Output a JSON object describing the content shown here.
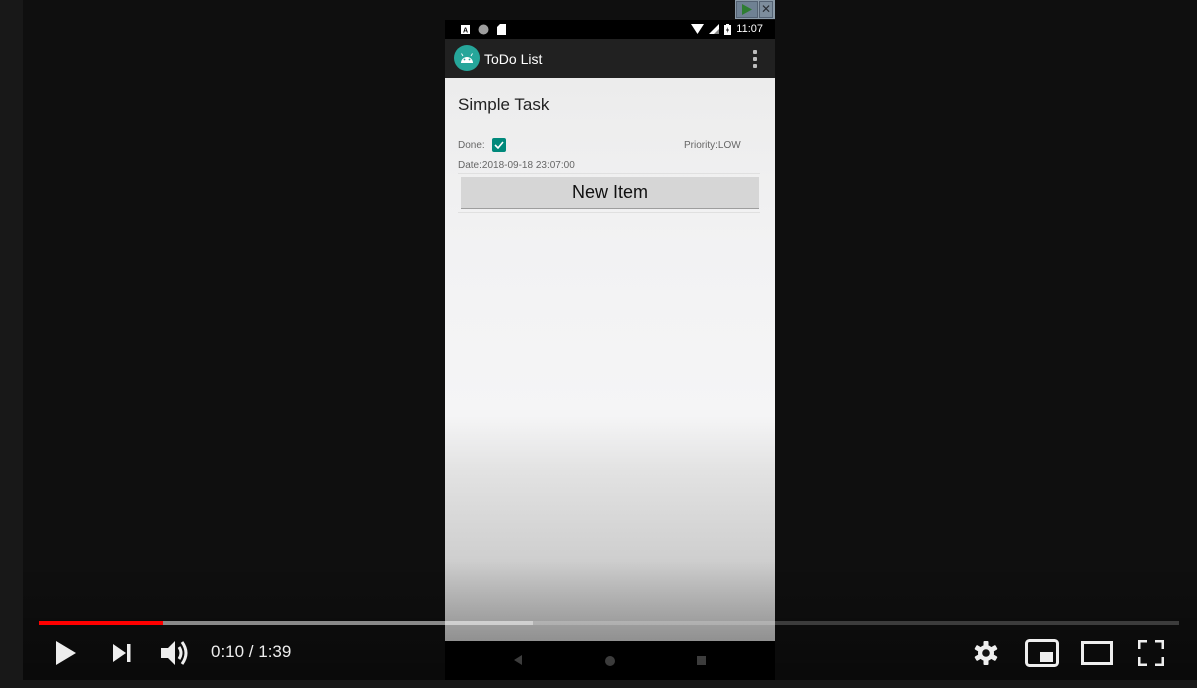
{
  "emulator": {
    "status_bar": {
      "left_icons": [
        "a-notification-icon",
        "circle-notification-icon",
        "sd-card-icon"
      ],
      "time": "11:07"
    },
    "app_bar": {
      "title": "ToDo List",
      "icon": "android-icon",
      "overflow_icon": "more-vert-icon"
    },
    "task": {
      "title": "Simple Task",
      "done_label": "Done:",
      "done_checked": true,
      "priority": "Priority:LOW",
      "date": "Date:2018-09-18 23:07:00"
    },
    "new_item_button": "New Item",
    "nav_bar": [
      "back-icon",
      "home-icon",
      "recents-icon"
    ]
  },
  "player": {
    "current_time": "0:10",
    "duration": "1:39",
    "time_display": "0:10 / 1:39",
    "played_fraction": 0.109,
    "buffered_fraction": 0.433,
    "colors": {
      "played": "#ff0000",
      "background": "#181818"
    },
    "controls": [
      "play",
      "next",
      "volume",
      "settings",
      "miniplayer",
      "theater",
      "fullscreen"
    ]
  }
}
